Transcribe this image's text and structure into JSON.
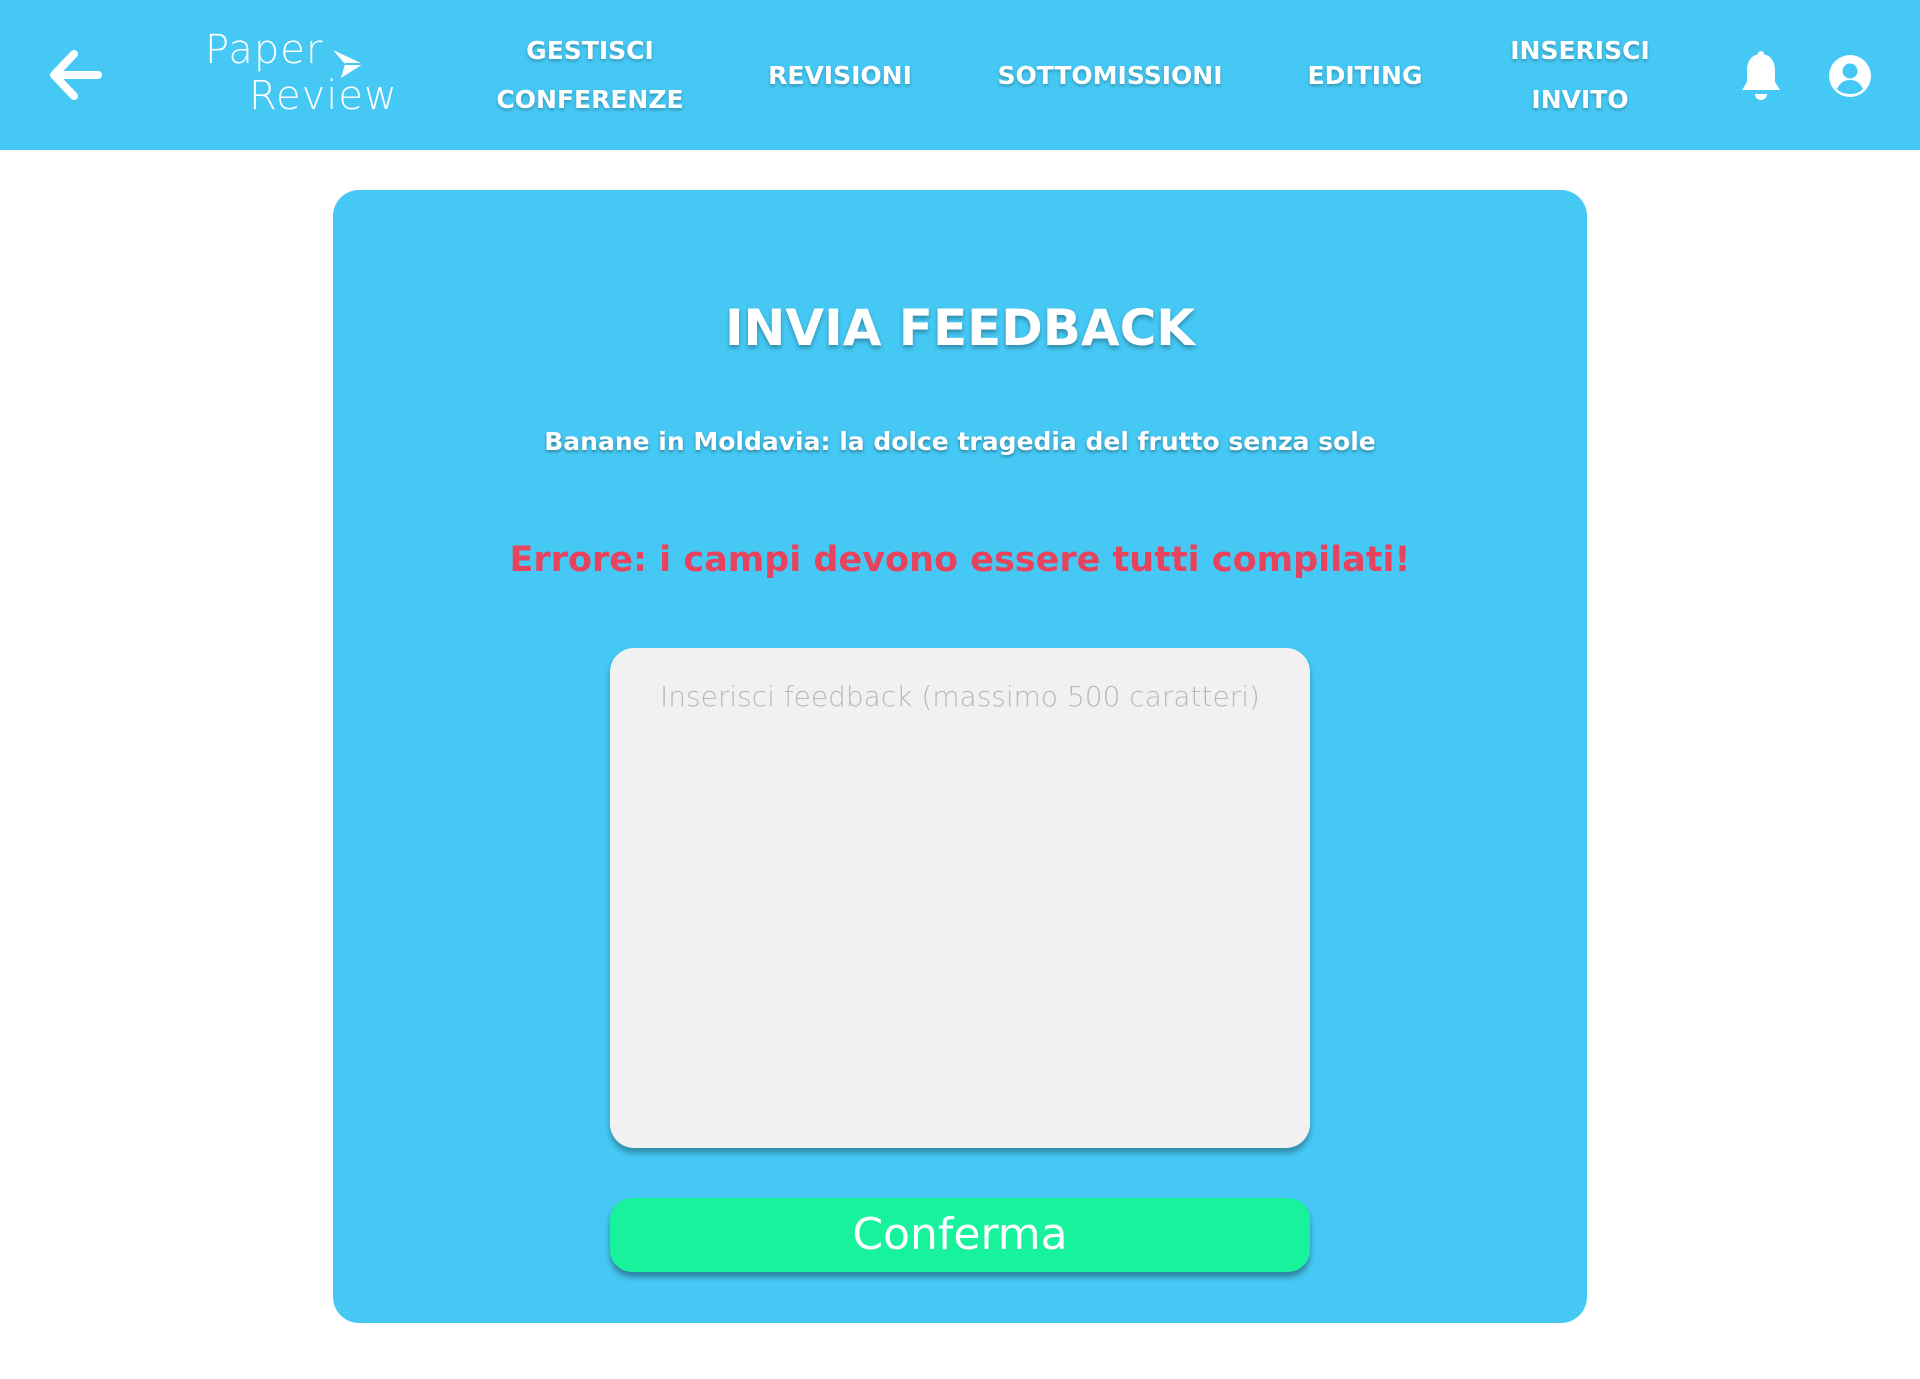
{
  "header": {
    "back_icon": "arrow-left-icon",
    "logo": {
      "line1": "Paper",
      "line2": "Review",
      "icon": "paper-plane-icon"
    },
    "nav": {
      "gestisci_conferenze": "GESTISCI\nCONFERENZE",
      "revisioni": "REVISIONI",
      "sottomissioni": "SOTTOMISSIONI",
      "editing": "EDITING",
      "inserisci_invito": "INSERISCI\nINVITO"
    },
    "notifications_icon": "bell-icon",
    "account_icon": "account-circle-icon"
  },
  "form": {
    "title": "INVIA FEEDBACK",
    "paper_title": "Banane in Moldavia: la dolce tragedia del frutto senza sole",
    "error": "Errore: i campi devono essere tutti compilati!",
    "feedback_value": "",
    "feedback_placeholder": "Inserisci feedback (massimo 500 caratteri)",
    "confirm_label": "Conferma"
  },
  "colors": {
    "primary": "#45c8f4",
    "error": "#e8435d",
    "confirm": "#18f29d",
    "input_background": "#f1f1f1"
  }
}
